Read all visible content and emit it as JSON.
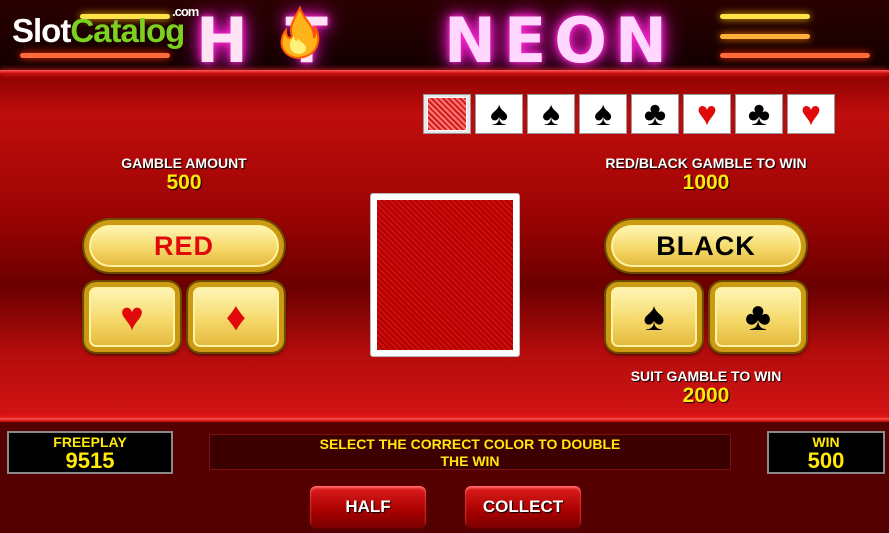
{
  "watermark": {
    "part1": "Slot",
    "part2": "Catalog",
    "part3": ".com"
  },
  "title": {
    "word1": "H T",
    "word2": "NEON"
  },
  "history": {
    "cards": [
      {
        "type": "back"
      },
      {
        "suit": "spade",
        "glyph": "♠",
        "color": "black"
      },
      {
        "suit": "spade",
        "glyph": "♠",
        "color": "black"
      },
      {
        "suit": "spade",
        "glyph": "♠",
        "color": "black"
      },
      {
        "suit": "club",
        "glyph": "♣",
        "color": "black"
      },
      {
        "suit": "heart",
        "glyph": "♥",
        "color": "red"
      },
      {
        "suit": "club",
        "glyph": "♣",
        "color": "black"
      },
      {
        "suit": "heart",
        "glyph": "♥",
        "color": "red"
      }
    ]
  },
  "gamble_amount": {
    "label": "GAMBLE AMOUNT",
    "value": "500"
  },
  "color_win": {
    "label": "RED/BLACK GAMBLE TO WIN",
    "value": "1000"
  },
  "suit_win": {
    "label": "SUIT GAMBLE TO WIN",
    "value": "2000"
  },
  "buttons": {
    "red": "RED",
    "black": "BLACK",
    "heart": "♥",
    "diamond": "♦",
    "spade": "♠",
    "club": "♣",
    "half": "HALF",
    "collect": "COLLECT"
  },
  "freeplay": {
    "label": "FREEPLAY",
    "value": "9515"
  },
  "win": {
    "label": "WIN",
    "value": "500"
  },
  "message": {
    "line1": "SELECT THE CORRECT COLOR TO DOUBLE",
    "line2": "THE WIN"
  },
  "colors": {
    "accent_yellow": "#ffe80a",
    "neon_pink": "#ff2bd6",
    "card_red": "#e00a0a"
  }
}
